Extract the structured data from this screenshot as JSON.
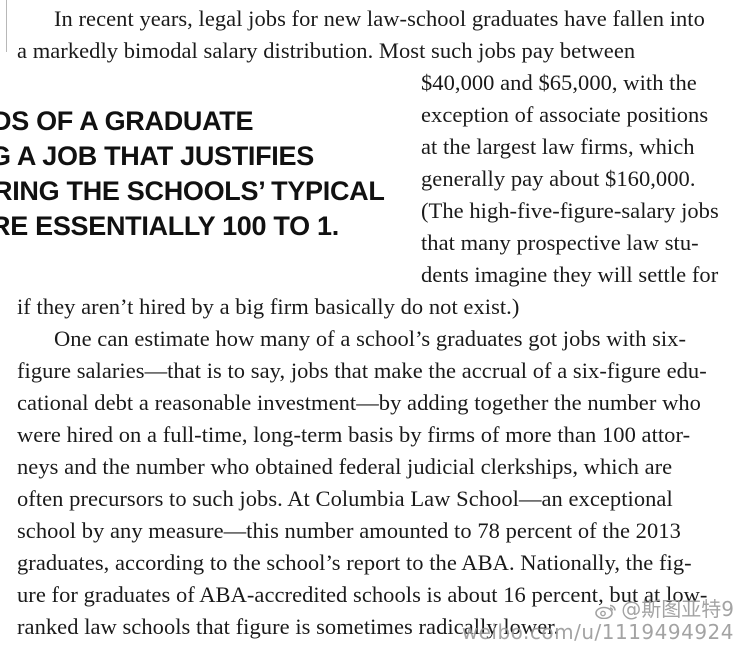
{
  "article": {
    "lines": [
      "In recent years, legal jobs for new law-school graduates have fallen into",
      "a markedly bimodal salary distribution. Most such jobs pay between",
      "$40,000 and $65,000, with the",
      "exception of associate positions",
      "at the largest law firms, which",
      "generally pay about $160,000.",
      "(The high-five-figure-salary jobs",
      "that many prospective law stu-",
      "dents imagine they will settle for",
      "if they aren’t hired by a big firm basically do not exist.)",
      "One can estimate how many of a school’s graduates got jobs with six-",
      "figure salaries—that is to say, jobs that make the accrual of a six-figure edu-",
      "cational debt a reasonable investment—by adding together the number who",
      "were hired on a full-time, long-term basis by firms of more than 100 attor-",
      "neys and the number who obtained federal judicial clerkships, which are",
      "often precursors to such jobs. At Columbia Law School—an exceptional",
      "school by any measure—this number amounted to 78 percent of the 2013",
      "graduates, according to the school’s report to the ABA. Nationally, the fig-",
      "ure for graduates of ABA-accredited schools is about 16 percent, but at low-",
      "ranked law schools that figure is sometimes radically lower."
    ]
  },
  "pull_quote": {
    "lines": [
      "DS OF A GRADUATE",
      "G A JOB THAT JUSTIFIES",
      "RING THE SCHOOLS’ TYPICAL",
      "RE ESSENTIALLY 100 TO 1."
    ]
  },
  "watermark": {
    "handle": "@斯图亚特9",
    "url": "weibo.com/u/1119494924"
  }
}
